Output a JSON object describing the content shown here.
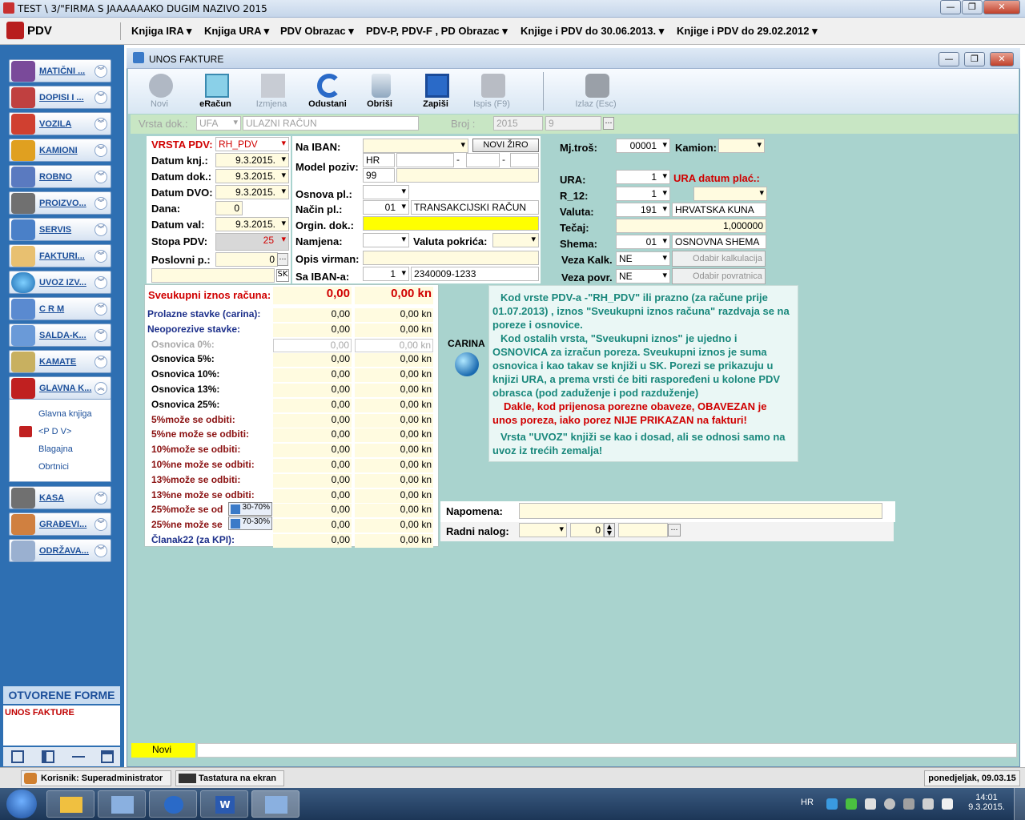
{
  "window": {
    "title": "TEST \\ 3/\"FIRMA S JAAAAAAKO DUGIM NAZIVO  2015"
  },
  "menu": {
    "app": "PDV",
    "items": [
      "Knjiga IRA",
      "Knjiga URA",
      "PDV Obrazac",
      "PDV-P, PDV-F , PD Obrazac",
      "Knjige i PDV do 30.06.2013.",
      "Knjige i PDV do  29.02.2012"
    ]
  },
  "sidebar": {
    "items": [
      {
        "label": "MATIČNI ...",
        "icon": "books-icon"
      },
      {
        "label": "DOPISI I ...",
        "icon": "letter-icon"
      },
      {
        "label": "VOZILA",
        "icon": "car-icon"
      },
      {
        "label": "KAMIONI",
        "icon": "truck-icon"
      },
      {
        "label": "ROBNO",
        "icon": "goods-icon"
      },
      {
        "label": "PROIZVO...",
        "icon": "hammer-icon"
      },
      {
        "label": "SERVIS",
        "icon": "service-icon"
      },
      {
        "label": "FAKTURI...",
        "icon": "invoice-icon"
      },
      {
        "label": "UVOZ IZV...",
        "icon": "globe-icon"
      },
      {
        "label": "C R M",
        "icon": "people-icon"
      },
      {
        "label": "SALDA-K...",
        "icon": "balance-icon"
      },
      {
        "label": "KAMATE",
        "icon": "money-icon"
      },
      {
        "label": "GLAVNA K...",
        "icon": "ledger-icon"
      }
    ],
    "subitems": [
      "Glavna knjiga",
      "<P D V>",
      "Blagajna",
      "Obrtnici"
    ],
    "bottom_items": [
      {
        "label": "KASA",
        "icon": "register-icon"
      },
      {
        "label": "GRAĐEVI...",
        "icon": "house-icon"
      },
      {
        "label": "ODRŽAVA...",
        "icon": "maintenance-icon"
      }
    ],
    "open_forms_title": "OTVORENE FORME",
    "open_forms": [
      "UNOS FAKTURE"
    ]
  },
  "form": {
    "title": "UNOS FAKTURE",
    "toolbar": [
      "Novi",
      "eRačun",
      "Izmjena",
      "Odustani",
      "Obriši",
      "Zapiši",
      "Ispis (F9)",
      "Izlaz (Esc)"
    ],
    "docbar": {
      "vrsta_label": "Vrsta dok.:",
      "vrsta_code": "UFA",
      "vrsta_name": "ULAZNI RAČUN",
      "broj_label": "Broj :",
      "year": "2015",
      "number": "9"
    },
    "left": {
      "vrsta_pdv_label": "VRSTA PDV:",
      "vrsta_pdv": "RH_PDV",
      "datum_knj_label": "Datum knj.:",
      "datum_knj": "9.3.2015.",
      "datum_dok_label": "Datum dok.:",
      "datum_dok": "9.3.2015.",
      "datum_dvo_label": "Datum DVO:",
      "datum_dvo": "9.3.2015.",
      "dana_label": "Dana:",
      "dana": "0",
      "datum_val_label": "Datum val:",
      "datum_val": "9.3.2015.",
      "stopa_label": "Stopa PDV:",
      "stopa": "25",
      "poslovni_label": "Poslovni p.:",
      "poslovni": "0",
      "sk": "SK"
    },
    "mid": {
      "iban_label": "Na IBAN:",
      "novi_ziro": "NOVI ŽIRO",
      "model_label": "Model poziv:",
      "model_country": "HR",
      "model_code": "99",
      "osnova_label": "Osnova pl.:",
      "nacin_label": "Način pl.:",
      "nacin_code": "01",
      "nacin_name": "TRANSAKCIJSKI RAČUN",
      "orgin_label": "Orgin. dok.:",
      "namjena_label": "Namjena:",
      "valuta_pokrica_label": "Valuta pokrića:",
      "opis_label": "Opis virman:",
      "sa_iban_label": "Sa IBAN-a:",
      "sa_iban_no": "1",
      "sa_iban": "2340009-1233"
    },
    "right": {
      "mjtros_label": "Mj.troš:",
      "mjtros": "00001",
      "kamion_label": "Kamion:",
      "ura_label": "URA:",
      "ura": "1",
      "ura_datum_label": "URA datum plać.:",
      "r12_label": "R_12:",
      "r12": "1",
      "valuta_label": "Valuta:",
      "valuta_code": "191",
      "valuta_name": "HRVATSKA KUNA",
      "tecaj_label": "Tečaj:",
      "tecaj": "1,000000",
      "shema_label": "Shema:",
      "shema_code": "01",
      "shema_name": "OSNOVNA SHEMA",
      "veza_kalk_label": "Veza Kalk.",
      "veza_kalk": "NE",
      "odabir_kalk": "Odabir kalkulacija",
      "veza_povr_label": "Veza povr.",
      "veza_povr": "NE",
      "odabir_povr": "Odabir povratnica"
    },
    "totals": {
      "label": "Sveukupni iznos računa:",
      "value": "0,00",
      "value_kn": "0,00 kn",
      "rows": [
        {
          "label": "Prolazne stavke (carina):",
          "v1": "0,00",
          "v2": "0,00 kn",
          "color": "#1c2f8a"
        },
        {
          "label": "Neoporezive stavke:",
          "v1": "0,00",
          "v2": "0,00 kn",
          "color": "#1c2f8a"
        },
        {
          "label": "Osnovica 0%:",
          "v1": "0,00",
          "v2": "0,00 kn",
          "color": "#a8a8a8"
        },
        {
          "label": "Osnovica 5%:",
          "v1": "0,00",
          "v2": "0,00 kn",
          "color": "#000000"
        },
        {
          "label": "Osnovica 10%:",
          "v1": "0,00",
          "v2": "0,00 kn",
          "color": "#000000"
        },
        {
          "label": "Osnovica 13%:",
          "v1": "0,00",
          "v2": "0,00 kn",
          "color": "#000000"
        },
        {
          "label": "Osnovica 25%:",
          "v1": "0,00",
          "v2": "0,00 kn",
          "color": "#000000"
        },
        {
          "label": "5%može se odbiti:",
          "v1": "0,00",
          "v2": "0,00 kn",
          "color": "#8a1010"
        },
        {
          "label": "5%ne može se odbiti:",
          "v1": "0,00",
          "v2": "0,00 kn",
          "color": "#8a1010"
        },
        {
          "label": "10%može se odbiti:",
          "v1": "0,00",
          "v2": "0,00 kn",
          "color": "#8a1010"
        },
        {
          "label": "10%ne može se odbiti:",
          "v1": "0,00",
          "v2": "0,00 kn",
          "color": "#8a1010"
        },
        {
          "label": "13%može se odbiti:",
          "v1": "0,00",
          "v2": "0,00 kn",
          "color": "#8a1010"
        },
        {
          "label": "13%ne može se odbiti:",
          "v1": "0,00",
          "v2": "0,00 kn",
          "color": "#8a1010"
        },
        {
          "label": "25%može se od",
          "v1": "0,00",
          "v2": "0,00 kn",
          "color": "#8a1010"
        },
        {
          "label": "25%ne može se",
          "v1": "0,00",
          "v2": "0,00 kn",
          "color": "#8a1010"
        },
        {
          "label": "Članak22 (za KPI):",
          "v1": "0,00",
          "v2": "0,00 kn",
          "color": "#1c2f8a"
        }
      ],
      "split1": "30-70%",
      "split2": "70-30%"
    },
    "carina": "CARINA",
    "info": {
      "p1": "Kod vrste PDV-a -\"RH_PDV\" ili prazno (za račune prije 01.07.2013) , iznos \"Sveukupni iznos računa\" razdvaja se na poreze i osnovice.",
      "p2": "Kod ostalih vrsta, \"Sveukupni iznos\" je ujedno i OSNOVICA za izračun poreza. Sveukupni iznos je suma osnovica i kao takav se knjiži u SK.  Porezi se prikazuju u knjizi URA, a prema vrsti će biti raspoređeni u kolone PDV obrasca (pod zaduženje i pod razduženje)",
      "p3": "Dakle, kod prijenosa porezne obaveze, OBAVEZAN je unos poreza, iako porez NIJE PRIKAZAN na fakturi!",
      "p4": "Vrsta \"UVOZ\" knjiži se kao i dosad, ali se odnosi samo na uvoz iz trećih zemalja!"
    },
    "napomena_label": "Napomena:",
    "radni_label": "Radni nalog:",
    "radni_value": "0",
    "status": "Novi"
  },
  "statusbar": {
    "user": "Korisnik: Superadministrator",
    "keyboard": "Tastatura na ekran",
    "date": "ponedjeljak, 09.03.15"
  },
  "taskbar": {
    "lang": "HR",
    "time": "14:01",
    "date": "9.3.2015."
  }
}
